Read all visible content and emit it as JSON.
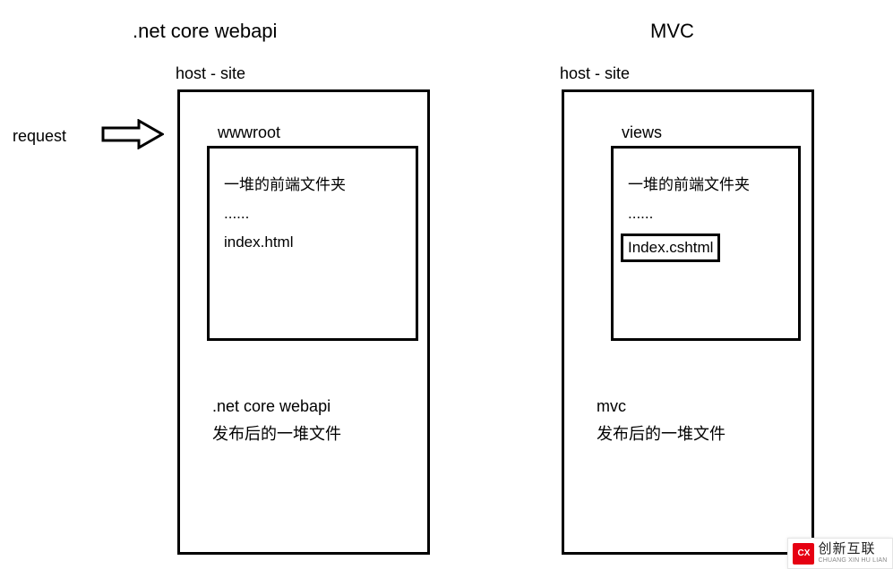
{
  "titles": {
    "left": ".net core webapi",
    "right": "MVC"
  },
  "request_label": "request",
  "host_label": "host - site",
  "left": {
    "folder": "wwwroot",
    "contents": {
      "line1": "一堆的前端文件夹",
      "line2": "......",
      "index": "index.html"
    },
    "bottom": {
      "line1": ".net core webapi",
      "line2": "发布后的一堆文件"
    }
  },
  "right": {
    "folder": "views",
    "contents": {
      "line1": "一堆的前端文件夹",
      "line2": "......",
      "index": "Index.cshtml"
    },
    "bottom": {
      "line1": "mvc",
      "line2": "发布后的一堆文件"
    }
  },
  "watermark": {
    "logo": "CX",
    "cn": "创新互联",
    "en": "CHUANG XIN HU LIAN"
  }
}
